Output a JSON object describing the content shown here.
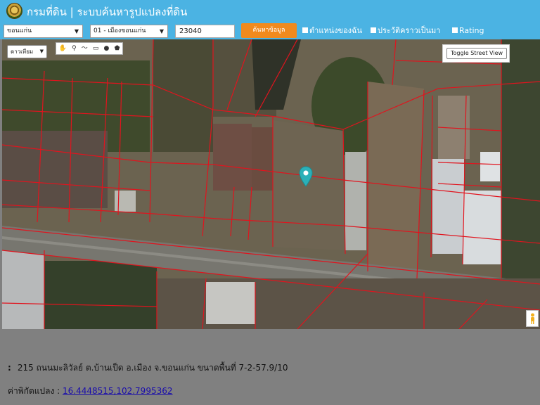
{
  "header": {
    "title": "กรมที่ดิน | ระบบค้นหารูปแปลงที่ดิน",
    "logo_icon": "land-department-seal"
  },
  "search": {
    "province": "ขอนแก่น",
    "district": "01 - เมืองขอนแก่น",
    "parcel_number": "23040",
    "submit_label": "ค้นหาข้อมูล"
  },
  "options": [
    {
      "label": "ตำแหน่งของฉัน"
    },
    {
      "label": "ประวัติคราวเป็นมา"
    },
    {
      "label": "Rating"
    }
  ],
  "map": {
    "map_type": "ดาวเทียม",
    "toggle_street_view_label": "Toggle Street View",
    "draw_tools": [
      "hand-icon",
      "marker-icon",
      "polyline-icon",
      "rectangle-icon",
      "circle-icon",
      "polygon-icon"
    ],
    "parcel_line_color": "#e0141e",
    "marker_color": "#2bb0b8"
  },
  "result": {
    "address_prefix": ":",
    "address": "215 ถนนมะลิวัลย์ ต.บ้านเป็ด  อ.เมือง  จ.ขอนแก่น  ขนาดพื้นที่ 7-2-57.9/10",
    "coord_label": "ค่าพิกัดแปลง :",
    "coord_value": "16.4448515,102.7995362"
  },
  "colors": {
    "header_bg": "#4bb3e3",
    "button_bg": "#f08a1e",
    "info_bg": "#808080"
  }
}
